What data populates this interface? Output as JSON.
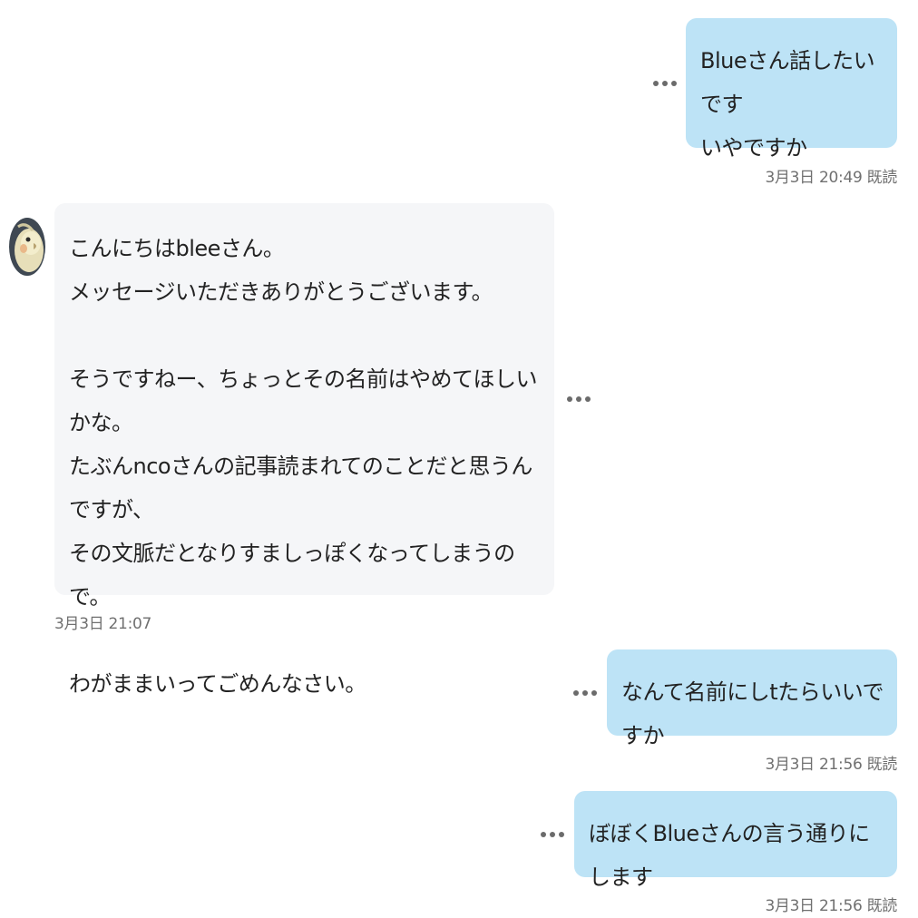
{
  "colors": {
    "outgoing_bubble": "#bde3f6",
    "incoming_bubble": "#f5f6f8",
    "meta_text": "#707070"
  },
  "messages": [
    {
      "direction": "outgoing",
      "text": "Blueさん話したいです\nいやですか",
      "time": "3月3日 20:49",
      "read_label": "既読",
      "more_icon": "more-horizontal-icon"
    },
    {
      "direction": "incoming",
      "avatar_icon": "bird-avatar-icon",
      "text": "こんにちはbleeさん。\nメッセージいただきありがとうございます。\n\nそうですねー、ちょっとその名前はやめてほしいかな。\nたぶんncoさんの記事読まれてのことだと思うんですが、\nその文脈だとなりすましっぽくなってしまうので。\n\nわがままいってごめんなさい。",
      "time": "3月3日 21:07",
      "more_icon": "more-horizontal-icon"
    },
    {
      "direction": "outgoing",
      "text": "なんて名前にしtたらいいですか",
      "time": "3月3日 21:56",
      "read_label": "既読",
      "more_icon": "more-horizontal-icon"
    },
    {
      "direction": "outgoing",
      "text": "ぼぼくBlueさんの言う通りにします",
      "time": "3月3日 21:56",
      "read_label": "既読",
      "more_icon": "more-horizontal-icon"
    }
  ]
}
